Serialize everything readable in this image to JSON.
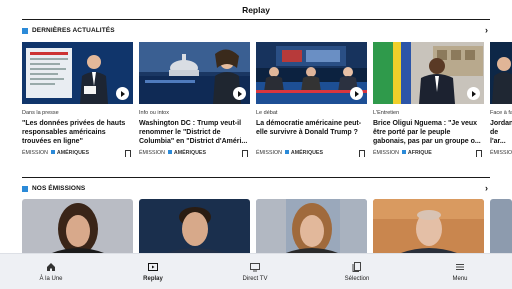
{
  "header": {
    "title": "Replay"
  },
  "sections": {
    "latest": {
      "title": "DERNIÈRES ACTUALITÉS"
    },
    "shows": {
      "title": "NOS ÉMISSIONS"
    }
  },
  "cards": [
    {
      "kicker": "Dans la presse",
      "title": "\"Les données privées de hauts responsables américains trouvées en ligne\"",
      "type": "ÉMISSION",
      "tag": "AMÉRIQUES"
    },
    {
      "kicker": "Info ou intox",
      "title": "Washington DC : Trump veut-il renommer le \"District de Columbia\" en \"District d'Améri...",
      "type": "ÉMISSION",
      "tag": "AMÉRIQUES"
    },
    {
      "kicker": "Le débat",
      "title": "La démocratie américaine peut-elle survivre à Donald Trump ?",
      "type": "ÉMISSION",
      "tag": "AMÉRIQUES"
    },
    {
      "kicker": "L'Entretien",
      "title": "Brice Oligui Nguema : \"Je veux être porté par le peuple gabonais, pas par un groupe o...",
      "type": "ÉMISSION",
      "tag": "AFRIQUE"
    },
    {
      "kicker": "Face à fa",
      "title": "Jordan... de l'ar...",
      "type": "ÉMISSIO",
      "tag": ""
    }
  ],
  "nav": [
    {
      "label": "À la Une",
      "icon": "home-icon"
    },
    {
      "label": "Replay",
      "icon": "replay-icon"
    },
    {
      "label": "Direct TV",
      "icon": "tv-icon"
    },
    {
      "label": "Sélection",
      "icon": "selection-icon"
    },
    {
      "label": "Menu",
      "icon": "menu-icon"
    }
  ],
  "colors": {
    "accent": "#2b8ad8",
    "nav_bg": "#eef0f4"
  }
}
